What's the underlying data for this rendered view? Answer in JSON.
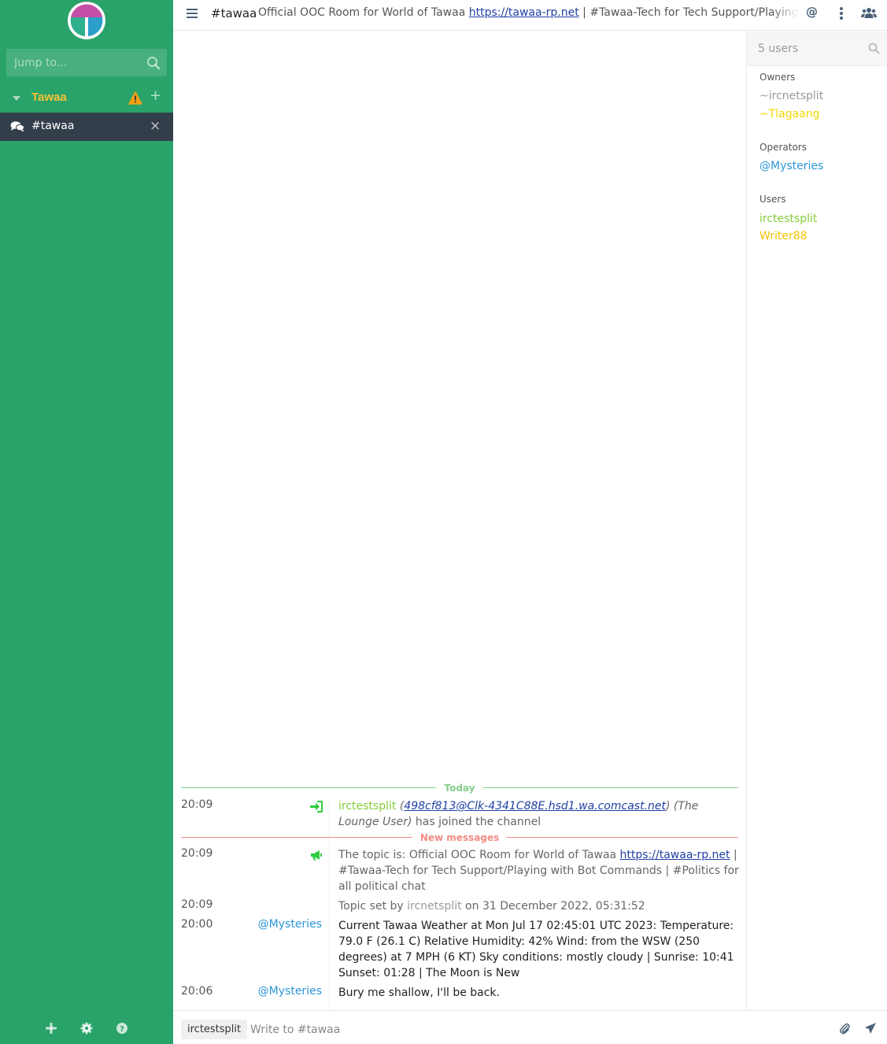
{
  "sidebar": {
    "search_placeholder": "Jump to...",
    "network": {
      "name": "Tawaa",
      "warning": true
    },
    "channels": [
      {
        "name": "#tawaa",
        "active": true
      }
    ]
  },
  "header": {
    "channel": "#tawaa",
    "topic_prefix": "Official OOC Room for World of Tawaa ",
    "topic_link": "https://tawaa-rp.net",
    "topic_suffix": " | #Tawaa-Tech for Tech Support/Playing with Bot Commands | #Politics for all political chat",
    "mention_glyph": "@"
  },
  "chat": {
    "date_divider": "Today",
    "unread_divider": "New messages",
    "messages": [
      {
        "time": "20:09",
        "type": "join",
        "nick": "irctestsplit",
        "host": "498cf813@Clk-4341C88E.hsd1.wa.comcast.net",
        "realname": "(The Lounge User)",
        "text": "has joined the channel"
      },
      {
        "time": "20:09",
        "type": "topic",
        "prefix": "The topic is: Official OOC Room for World of Tawaa ",
        "link": "https://tawaa-rp.net",
        "suffix": " | #Tawaa-Tech for Tech Support/Playing with Bot Commands | #Politics for all political chat"
      },
      {
        "time": "20:09",
        "type": "topic_set_by",
        "prefix": "Topic set by ",
        "nick": "ircnetsplit",
        "suffix": " on 31 December 2022, 05:31:52"
      },
      {
        "time": "20:00",
        "type": "message",
        "from": "@Mysteries",
        "text": "Current Tawaa Weather at Mon Jul 17 02:45:01 UTC 2023: Temperature: 79.0 F (26.1 C) Relative Humidity: 42% Wind: from the WSW (250 degrees) at 7 MPH (6 KT) Sky conditions: mostly cloudy | Sunrise: 10:41 Sunset: 01:28 | The Moon is New"
      },
      {
        "time": "20:06",
        "type": "message",
        "from": "@Mysteries",
        "text": "Bury me shallow, I'll be back."
      }
    ]
  },
  "userlist": {
    "search_placeholder": "5 users",
    "groups": [
      {
        "label": "Owners",
        "users": [
          "~ircnetsplit",
          "~Tlagaang"
        ]
      },
      {
        "label": "Operators",
        "users": [
          "@Mysteries"
        ]
      },
      {
        "label": "Users",
        "users": [
          "irctestsplit",
          "Writer88"
        ]
      }
    ]
  },
  "input": {
    "nick": "irctestsplit",
    "placeholder": "Write to #tawaa"
  },
  "colors": {
    "sidebar_bg": "#29a369",
    "active_channel_bg": "#333e4b",
    "network_name": "#f7c137",
    "join_nick": "#84ce39",
    "mysteries": "#2b96d7",
    "tlagaang": "#f2d600",
    "writer88": "#f2c200",
    "unread_divider": "#f28b82",
    "date_divider": "#84ce88"
  }
}
